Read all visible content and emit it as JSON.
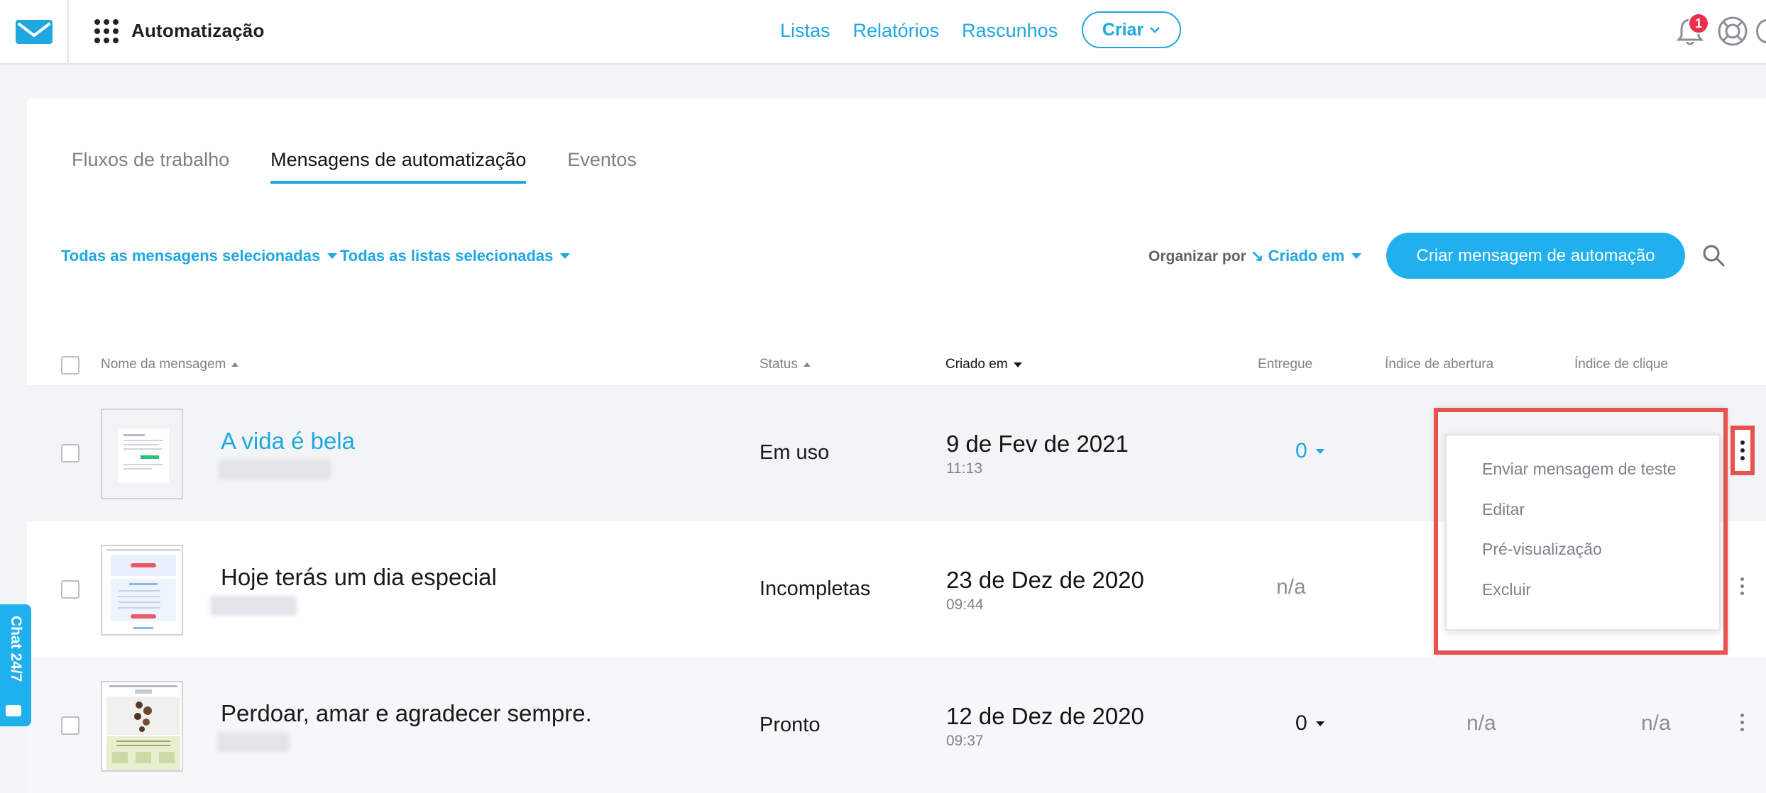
{
  "header": {
    "app_title": "Automatização",
    "nav": [
      "Listas",
      "Relatórios",
      "Rascunhos"
    ],
    "create_label": "Criar",
    "notification_count": "1",
    "accent_color": "#1fa7e0"
  },
  "tabs": [
    {
      "label": "Fluxos de trabalho",
      "active": false
    },
    {
      "label": "Mensagens de automatização",
      "active": true
    },
    {
      "label": "Eventos",
      "active": false
    }
  ],
  "filters": {
    "messages": "Todas as mensagens selecionadas",
    "lists": "Todas as listas selecionadas",
    "sort_label": "Organizar por",
    "sort_value": "↘ Criado em",
    "create_button": "Criar mensagem de automação"
  },
  "table": {
    "columns": [
      "Nome da mensagem",
      "Status",
      "Criado em",
      "Entregue",
      "Índice de abertura",
      "Índice de clique"
    ],
    "rows": [
      {
        "name": "A vida é bela",
        "status": "Em uso",
        "date": "9 de Fev de 2021",
        "time": "11:13",
        "delivered": "0",
        "open_rate": "",
        "click_rate": ""
      },
      {
        "name": "Hoje terás um dia especial",
        "status": "Incompletas",
        "date": "23 de Dez de 2020",
        "time": "09:44",
        "delivered": "n/a",
        "open_rate": "",
        "click_rate": ""
      },
      {
        "name": "Perdoar, amar e agradecer sempre.",
        "status": "Pronto",
        "date": "12 de Dez de 2020",
        "time": "09:37",
        "delivered": "0",
        "open_rate": "n/a",
        "click_rate": "n/a"
      }
    ]
  },
  "menu": {
    "items": [
      "Enviar mensagem de teste",
      "Editar",
      "Pré-visualização",
      "Excluir"
    ],
    "highlight_color": "#e9514e"
  },
  "chat": {
    "label": "Chat 24/7"
  }
}
